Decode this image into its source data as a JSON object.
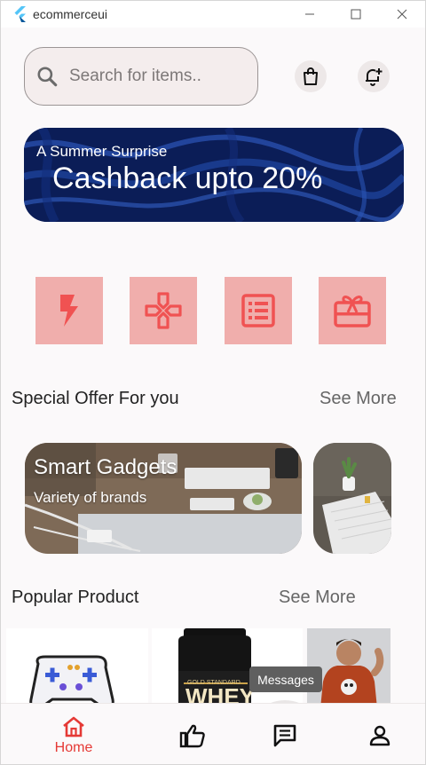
{
  "window": {
    "title": "ecommerceui"
  },
  "search": {
    "placeholder": "Search for items.."
  },
  "header": {
    "cart_icon": "shopping-bag-icon",
    "notification_icon": "notification-add-icon"
  },
  "banner": {
    "subtitle": "A Summer Surprise",
    "title": "Cashback upto 20%"
  },
  "categories": [
    {
      "icon": "flash-icon"
    },
    {
      "icon": "gamepad-icon"
    },
    {
      "icon": "bill-icon"
    },
    {
      "icon": "gift-icon"
    }
  ],
  "special_offers": {
    "title": "Special Offer For you",
    "see_more": "See More",
    "cards": [
      {
        "title": "Smart Gadgets",
        "subtitle": "Variety of brands"
      },
      {
        "title": "",
        "subtitle": ""
      }
    ]
  },
  "popular": {
    "title": "Popular Product",
    "see_more": "See More",
    "products": [
      {
        "image": "game-controller"
      },
      {
        "image": "whey-protein-jar",
        "label_small": "GOLD STANDARD",
        "label_big": "WHEY"
      },
      {
        "image": "tshirt-model"
      }
    ]
  },
  "tooltip": {
    "text": "Messages"
  },
  "nav": {
    "home_label": "Home",
    "accent": "#e53935"
  },
  "colors": {
    "category_bg": "#f0aeac",
    "category_icon": "#f05252",
    "banner_bg": "#0c1f5c"
  }
}
